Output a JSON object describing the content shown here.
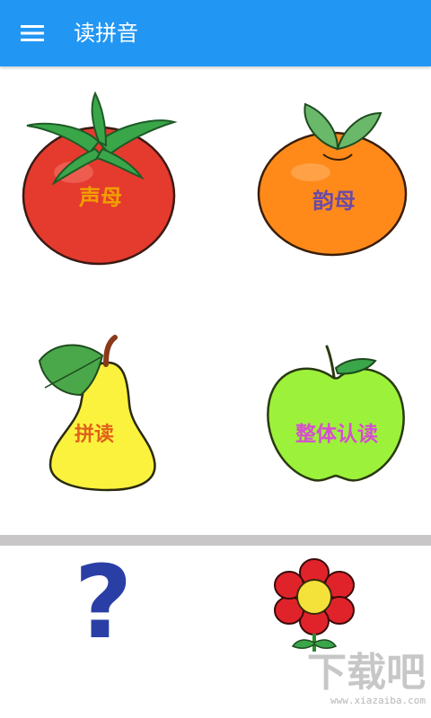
{
  "app_bar": {
    "title": "读拼音",
    "menu_icon": "hamburger-menu-icon",
    "background": "#2196f3"
  },
  "fruits": [
    {
      "id": "tomato",
      "label": "声母",
      "label_color": "#f0a000",
      "icon": "tomato-icon"
    },
    {
      "id": "orange",
      "label": "韵母",
      "label_color": "#6a4aa8",
      "icon": "orange-icon"
    },
    {
      "id": "pear",
      "label": "拼读",
      "label_color": "#e0611a",
      "icon": "pear-icon"
    },
    {
      "id": "apple",
      "label": "整体认读",
      "label_color": "#d64ed0",
      "icon": "apple-icon"
    }
  ],
  "bottom": {
    "help_symbol": "?",
    "help_icon": "question-mark-icon",
    "flower_icon": "flower-icon"
  },
  "watermark": {
    "text": "下载吧",
    "url": "www.xiazaiba.com"
  }
}
